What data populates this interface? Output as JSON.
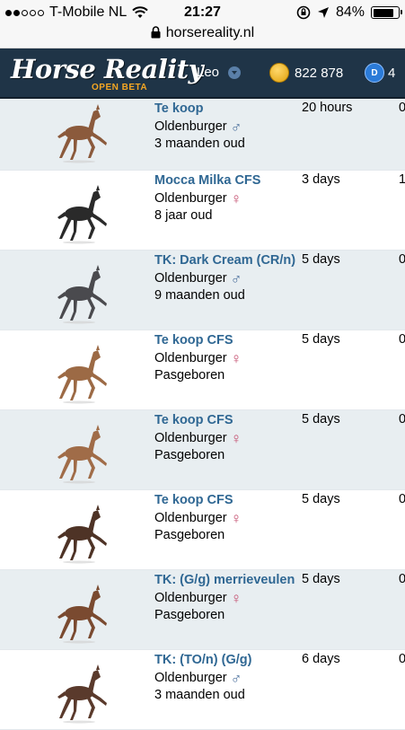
{
  "status_bar": {
    "carrier": "T-Mobile NL",
    "time": "21:27",
    "battery": "84%",
    "battery_level": 0.84
  },
  "url_bar": {
    "url": "horsereality.nl"
  },
  "header": {
    "logo": "Horse Reality",
    "beta": "OPEN BETA",
    "username": "Leo",
    "coins": "822 878",
    "points": "4",
    "points_badge": "D"
  },
  "listings": [
    {
      "name": "Te koop",
      "breed": "Oldenburger",
      "gender_symbol": "♂",
      "gender": "m",
      "age": "3 maanden oud",
      "time": "20 hours",
      "extra": "0",
      "coat": "#8b5a3c"
    },
    {
      "name": "Mocca Milka CFS",
      "breed": "Oldenburger",
      "gender_symbol": "♀",
      "gender": "f",
      "age": "8 jaar oud",
      "time": "3 days",
      "extra": "1",
      "coat": "#2a2a2a"
    },
    {
      "name": "TK: Dark Cream (CR/n)",
      "breed": "Oldenburger",
      "gender_symbol": "♂",
      "gender": "m",
      "age": "9 maanden oud",
      "time": "5 days",
      "extra": "0",
      "coat": "#4a4a4e"
    },
    {
      "name": "Te koop CFS",
      "breed": "Oldenburger",
      "gender_symbol": "♀",
      "gender": "f",
      "age": "Pasgeboren",
      "time": "5 days",
      "extra": "0",
      "coat": "#9c6a45"
    },
    {
      "name": "Te koop CFS",
      "breed": "Oldenburger",
      "gender_symbol": "♀",
      "gender": "f",
      "age": "Pasgeboren",
      "time": "5 days",
      "extra": "0",
      "coat": "#a06c48"
    },
    {
      "name": "Te koop CFS",
      "breed": "Oldenburger",
      "gender_symbol": "♀",
      "gender": "f",
      "age": "Pasgeboren",
      "time": "5 days",
      "extra": "0",
      "coat": "#4e3326"
    },
    {
      "name": "TK: (G/g) merrieveulen",
      "breed": "Oldenburger",
      "gender_symbol": "♀",
      "gender": "f",
      "age": "Pasgeboren",
      "time": "5 days",
      "extra": "0",
      "coat": "#7a4a30"
    },
    {
      "name": "TK: (TO/n) (G/g)",
      "breed": "Oldenburger",
      "gender_symbol": "♂",
      "gender": "m",
      "age": "3 maanden oud",
      "time": "6 days",
      "extra": "0",
      "coat": "#5a3a2c"
    }
  ]
}
